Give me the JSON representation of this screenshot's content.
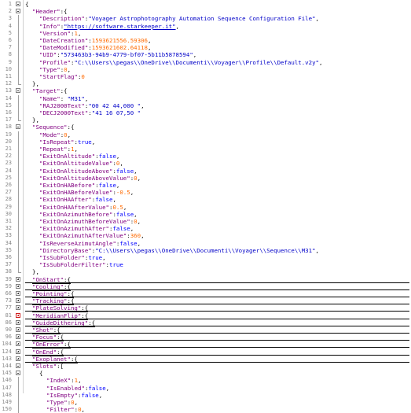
{
  "lines": [
    {
      "n": "1",
      "indent": 0,
      "fold": "minus",
      "parts": [
        {
          "t": "{",
          "c": "p"
        }
      ]
    },
    {
      "n": "2",
      "indent": 1,
      "fold": "minus",
      "parts": [
        {
          "t": "\"Header\"",
          "c": "k"
        },
        {
          "t": ":{",
          "c": "p"
        }
      ]
    },
    {
      "n": "3",
      "indent": 2,
      "fold": "",
      "parts": [
        {
          "t": "\"Description\"",
          "c": "k"
        },
        {
          "t": ":",
          "c": "p"
        },
        {
          "t": "\"Voyager Astrophotography Automation Sequence Configuration File\"",
          "c": "s"
        },
        {
          "t": ",",
          "c": "p"
        }
      ]
    },
    {
      "n": "4",
      "indent": 2,
      "fold": "",
      "parts": [
        {
          "t": "\"Info\"",
          "c": "k"
        },
        {
          "t": ":",
          "c": "p"
        },
        {
          "t": "\"https://software.starkeeper.it\"",
          "c": "u"
        },
        {
          "t": ",",
          "c": "p"
        }
      ]
    },
    {
      "n": "5",
      "indent": 2,
      "fold": "",
      "parts": [
        {
          "t": "\"Version\"",
          "c": "k"
        },
        {
          "t": ":",
          "c": "p"
        },
        {
          "t": "1",
          "c": "n"
        },
        {
          "t": ",",
          "c": "p"
        }
      ]
    },
    {
      "n": "6",
      "indent": 2,
      "fold": "",
      "parts": [
        {
          "t": "\"DateCreation\"",
          "c": "k"
        },
        {
          "t": ":",
          "c": "p"
        },
        {
          "t": "1593621556.59306",
          "c": "n"
        },
        {
          "t": ",",
          "c": "p"
        }
      ]
    },
    {
      "n": "7",
      "indent": 2,
      "fold": "",
      "parts": [
        {
          "t": "\"DateModified\"",
          "c": "k"
        },
        {
          "t": ":",
          "c": "p"
        },
        {
          "t": "1593621602.64118",
          "c": "n"
        },
        {
          "t": ",",
          "c": "p"
        }
      ]
    },
    {
      "n": "8",
      "indent": 2,
      "fold": "",
      "parts": [
        {
          "t": "\"UID\"",
          "c": "k"
        },
        {
          "t": ":",
          "c": "p"
        },
        {
          "t": "\"573463b3-94b9-4779-bf07-5b11b5878594\"",
          "c": "s"
        },
        {
          "t": ",",
          "c": "p"
        }
      ]
    },
    {
      "n": "9",
      "indent": 2,
      "fold": "",
      "parts": [
        {
          "t": "\"Profile\"",
          "c": "k"
        },
        {
          "t": ":",
          "c": "p"
        },
        {
          "t": "\"C:\\\\Users\\\\pegas\\\\OneDrive\\\\Documenti\\\\Voyager\\\\Profile\\\\Default.v2y\"",
          "c": "s"
        },
        {
          "t": ",",
          "c": "p"
        }
      ]
    },
    {
      "n": "10",
      "indent": 2,
      "fold": "",
      "parts": [
        {
          "t": "\"Type\"",
          "c": "k"
        },
        {
          "t": ":",
          "c": "p"
        },
        {
          "t": "0",
          "c": "n"
        },
        {
          "t": ",",
          "c": "p"
        }
      ]
    },
    {
      "n": "11",
      "indent": 2,
      "fold": "",
      "parts": [
        {
          "t": "\"StartFlag\"",
          "c": "k"
        },
        {
          "t": ":",
          "c": "p"
        },
        {
          "t": "0",
          "c": "n"
        }
      ]
    },
    {
      "n": "12",
      "indent": 1,
      "fold": "end",
      "parts": [
        {
          "t": "},",
          "c": "p"
        }
      ]
    },
    {
      "n": "13",
      "indent": 1,
      "fold": "minus",
      "parts": [
        {
          "t": "\"Target\"",
          "c": "k"
        },
        {
          "t": ":{",
          "c": "p"
        }
      ]
    },
    {
      "n": "14",
      "indent": 2,
      "fold": "",
      "parts": [
        {
          "t": "\"Name\"",
          "c": "k"
        },
        {
          "t": ": ",
          "c": "p"
        },
        {
          "t": "\"M31\"",
          "c": "s"
        },
        {
          "t": ",",
          "c": "p"
        }
      ]
    },
    {
      "n": "15",
      "indent": 2,
      "fold": "",
      "parts": [
        {
          "t": "\"RAJ2000Text\"",
          "c": "k"
        },
        {
          "t": ":",
          "c": "p"
        },
        {
          "t": "\"00 42 44,000 \"",
          "c": "s"
        },
        {
          "t": ",",
          "c": "p"
        }
      ]
    },
    {
      "n": "16",
      "indent": 2,
      "fold": "",
      "parts": [
        {
          "t": "\"DECJ2000Text\"",
          "c": "k"
        },
        {
          "t": ":",
          "c": "p"
        },
        {
          "t": "\"41 16 07,50 \"",
          "c": "s"
        }
      ]
    },
    {
      "n": "17",
      "indent": 1,
      "fold": "end",
      "parts": [
        {
          "t": "},",
          "c": "p"
        }
      ]
    },
    {
      "n": "18",
      "indent": 1,
      "fold": "minus",
      "parts": [
        {
          "t": "\"Sequence\"",
          "c": "k"
        },
        {
          "t": ":{",
          "c": "p"
        }
      ]
    },
    {
      "n": "19",
      "indent": 2,
      "fold": "",
      "parts": [
        {
          "t": "\"Mode\"",
          "c": "k"
        },
        {
          "t": ":",
          "c": "p"
        },
        {
          "t": "0",
          "c": "n"
        },
        {
          "t": ",",
          "c": "p"
        }
      ]
    },
    {
      "n": "20",
      "indent": 2,
      "fold": "",
      "parts": [
        {
          "t": "\"IsRepeat\"",
          "c": "k"
        },
        {
          "t": ":",
          "c": "p"
        },
        {
          "t": "true",
          "c": "b"
        },
        {
          "t": ",",
          "c": "p"
        }
      ]
    },
    {
      "n": "21",
      "indent": 2,
      "fold": "",
      "parts": [
        {
          "t": "\"Repeat\"",
          "c": "k"
        },
        {
          "t": ":",
          "c": "p"
        },
        {
          "t": "1",
          "c": "n"
        },
        {
          "t": ",",
          "c": "p"
        }
      ]
    },
    {
      "n": "22",
      "indent": 2,
      "fold": "",
      "parts": [
        {
          "t": "\"ExitOnAltitude\"",
          "c": "k"
        },
        {
          "t": ":",
          "c": "p"
        },
        {
          "t": "false",
          "c": "b"
        },
        {
          "t": ",",
          "c": "p"
        }
      ]
    },
    {
      "n": "23",
      "indent": 2,
      "fold": "",
      "parts": [
        {
          "t": "\"ExitOnAltitudeValue\"",
          "c": "k"
        },
        {
          "t": ":",
          "c": "p"
        },
        {
          "t": "0",
          "c": "n"
        },
        {
          "t": ",",
          "c": "p"
        }
      ]
    },
    {
      "n": "24",
      "indent": 2,
      "fold": "",
      "parts": [
        {
          "t": "\"ExitOnAltitudeAbove\"",
          "c": "k"
        },
        {
          "t": ":",
          "c": "p"
        },
        {
          "t": "false",
          "c": "b"
        },
        {
          "t": ",",
          "c": "p"
        }
      ]
    },
    {
      "n": "25",
      "indent": 2,
      "fold": "",
      "parts": [
        {
          "t": "\"ExitOnAltitudeAboveValue\"",
          "c": "k"
        },
        {
          "t": ":",
          "c": "p"
        },
        {
          "t": "0",
          "c": "n"
        },
        {
          "t": ",",
          "c": "p"
        }
      ]
    },
    {
      "n": "26",
      "indent": 2,
      "fold": "",
      "parts": [
        {
          "t": "\"ExitOnHABefore\"",
          "c": "k"
        },
        {
          "t": ":",
          "c": "p"
        },
        {
          "t": "false",
          "c": "b"
        },
        {
          "t": ",",
          "c": "p"
        }
      ]
    },
    {
      "n": "27",
      "indent": 2,
      "fold": "",
      "parts": [
        {
          "t": "\"ExitOnHABeforeValue\"",
          "c": "k"
        },
        {
          "t": ":",
          "c": "p"
        },
        {
          "t": "-0.5",
          "c": "n"
        },
        {
          "t": ",",
          "c": "p"
        }
      ]
    },
    {
      "n": "28",
      "indent": 2,
      "fold": "",
      "parts": [
        {
          "t": "\"ExitOnHAAfter\"",
          "c": "k"
        },
        {
          "t": ":",
          "c": "p"
        },
        {
          "t": "false",
          "c": "b"
        },
        {
          "t": ",",
          "c": "p"
        }
      ]
    },
    {
      "n": "29",
      "indent": 2,
      "fold": "",
      "parts": [
        {
          "t": "\"ExitOnHAAfterValue\"",
          "c": "k"
        },
        {
          "t": ":",
          "c": "p"
        },
        {
          "t": "0.5",
          "c": "n"
        },
        {
          "t": ",",
          "c": "p"
        }
      ]
    },
    {
      "n": "30",
      "indent": 2,
      "fold": "",
      "parts": [
        {
          "t": "\"ExitOnAzimuthBefore\"",
          "c": "k"
        },
        {
          "t": ":",
          "c": "p"
        },
        {
          "t": "false",
          "c": "b"
        },
        {
          "t": ",",
          "c": "p"
        }
      ]
    },
    {
      "n": "31",
      "indent": 2,
      "fold": "",
      "parts": [
        {
          "t": "\"ExitOnAzimuthBeforeValue\"",
          "c": "k"
        },
        {
          "t": ":",
          "c": "p"
        },
        {
          "t": "0",
          "c": "n"
        },
        {
          "t": ",",
          "c": "p"
        }
      ]
    },
    {
      "n": "32",
      "indent": 2,
      "fold": "",
      "parts": [
        {
          "t": "\"ExitOnAzimuthAfter\"",
          "c": "k"
        },
        {
          "t": ":",
          "c": "p"
        },
        {
          "t": "false",
          "c": "b"
        },
        {
          "t": ",",
          "c": "p"
        }
      ]
    },
    {
      "n": "33",
      "indent": 2,
      "fold": "",
      "parts": [
        {
          "t": "\"ExitOnAzimuthAfterValue\"",
          "c": "k"
        },
        {
          "t": ":",
          "c": "p"
        },
        {
          "t": "360",
          "c": "n"
        },
        {
          "t": ",",
          "c": "p"
        }
      ]
    },
    {
      "n": "34",
      "indent": 2,
      "fold": "",
      "parts": [
        {
          "t": "\"IsReverseAzimutAngle\"",
          "c": "k"
        },
        {
          "t": ":",
          "c": "p"
        },
        {
          "t": "false",
          "c": "b"
        },
        {
          "t": ",",
          "c": "p"
        }
      ]
    },
    {
      "n": "35",
      "indent": 2,
      "fold": "",
      "parts": [
        {
          "t": "\"DirectoryBase\"",
          "c": "k"
        },
        {
          "t": ":",
          "c": "p"
        },
        {
          "t": "\"C:\\\\Users\\\\pegas\\\\OneDrive\\\\Documenti\\\\Voyager\\\\Sequence\\\\M31\"",
          "c": "s"
        },
        {
          "t": ",",
          "c": "p"
        }
      ]
    },
    {
      "n": "36",
      "indent": 2,
      "fold": "",
      "parts": [
        {
          "t": "\"IsSubFolder\"",
          "c": "k"
        },
        {
          "t": ":",
          "c": "p"
        },
        {
          "t": "true",
          "c": "b"
        },
        {
          "t": ",",
          "c": "p"
        }
      ]
    },
    {
      "n": "37",
      "indent": 2,
      "fold": "",
      "parts": [
        {
          "t": "\"IsSubFolderFilter\"",
          "c": "k"
        },
        {
          "t": ":",
          "c": "p"
        },
        {
          "t": "true",
          "c": "b"
        }
      ]
    },
    {
      "n": "38",
      "indent": 1,
      "fold": "end",
      "parts": [
        {
          "t": "},",
          "c": "p"
        }
      ]
    },
    {
      "n": "39",
      "indent": 1,
      "fold": "plus",
      "parts": [
        {
          "t": "\"OnStart\"",
          "c": "k"
        },
        {
          "t": ":{",
          "c": "p"
        }
      ]
    },
    {
      "n": "59",
      "indent": 1,
      "fold": "plus",
      "parts": [
        {
          "t": "\"Cooling\"",
          "c": "k"
        },
        {
          "t": ":{",
          "c": "p"
        }
      ]
    },
    {
      "n": "66",
      "indent": 1,
      "fold": "plus",
      "parts": [
        {
          "t": "\"Pointing\"",
          "c": "k"
        },
        {
          "t": ":{",
          "c": "p"
        }
      ]
    },
    {
      "n": "73",
      "indent": 1,
      "fold": "plus",
      "parts": [
        {
          "t": "\"Tracking\"",
          "c": "k"
        },
        {
          "t": ":{",
          "c": "p"
        }
      ]
    },
    {
      "n": "77",
      "indent": 1,
      "fold": "plus",
      "parts": [
        {
          "t": "\"PlateSolving\"",
          "c": "k"
        },
        {
          "t": ":{",
          "c": "p"
        }
      ]
    },
    {
      "n": "81",
      "indent": 1,
      "fold": "plusred",
      "parts": [
        {
          "t": "\"MeridianFlip\"",
          "c": "k"
        },
        {
          "t": ":{",
          "c": "p"
        }
      ]
    },
    {
      "n": "86",
      "indent": 1,
      "fold": "plus",
      "parts": [
        {
          "t": "\"GuideDithering\"",
          "c": "k"
        },
        {
          "t": ":{",
          "c": "p"
        }
      ]
    },
    {
      "n": "90",
      "indent": 1,
      "fold": "plus",
      "parts": [
        {
          "t": "\"Shot\"",
          "c": "k"
        },
        {
          "t": ":{",
          "c": "p"
        }
      ]
    },
    {
      "n": "96",
      "indent": 1,
      "fold": "plus",
      "parts": [
        {
          "t": "\"Focus\"",
          "c": "k"
        },
        {
          "t": ":{",
          "c": "p"
        }
      ]
    },
    {
      "n": "104",
      "indent": 1,
      "fold": "plus",
      "parts": [
        {
          "t": "\"OnError\"",
          "c": "k"
        },
        {
          "t": ":{",
          "c": "p"
        }
      ]
    },
    {
      "n": "124",
      "indent": 1,
      "fold": "plus",
      "parts": [
        {
          "t": "\"OnEnd\"",
          "c": "k"
        },
        {
          "t": ":{",
          "c": "p"
        }
      ]
    },
    {
      "n": "143",
      "indent": 1,
      "fold": "plus",
      "parts": [
        {
          "t": "\"Exoplanet\"",
          "c": "k"
        },
        {
          "t": ":{",
          "c": "p"
        }
      ]
    },
    {
      "n": "144",
      "indent": 1,
      "fold": "minus",
      "parts": [
        {
          "t": "\"Slots\"",
          "c": "k"
        },
        {
          "t": ":[",
          "c": "p"
        }
      ]
    },
    {
      "n": "145",
      "indent": 2,
      "fold": "minus",
      "parts": [
        {
          "t": "{",
          "c": "p"
        }
      ]
    },
    {
      "n": "146",
      "indent": 3,
      "fold": "",
      "parts": [
        {
          "t": "\"IndeX\"",
          "c": "k"
        },
        {
          "t": ":",
          "c": "p"
        },
        {
          "t": "1",
          "c": "n"
        },
        {
          "t": ",",
          "c": "p"
        }
      ]
    },
    {
      "n": "147",
      "indent": 3,
      "fold": "",
      "parts": [
        {
          "t": "\"IsEnabled\"",
          "c": "k"
        },
        {
          "t": ":",
          "c": "p"
        },
        {
          "t": "false",
          "c": "b"
        },
        {
          "t": ",",
          "c": "p"
        }
      ]
    },
    {
      "n": "148",
      "indent": 3,
      "fold": "",
      "parts": [
        {
          "t": "\"IsEmpty\"",
          "c": "k"
        },
        {
          "t": ":",
          "c": "p"
        },
        {
          "t": "false",
          "c": "b"
        },
        {
          "t": ",",
          "c": "p"
        }
      ]
    },
    {
      "n": "149",
      "indent": 3,
      "fold": "",
      "parts": [
        {
          "t": "\"Type\"",
          "c": "k"
        },
        {
          "t": ":",
          "c": "p"
        },
        {
          "t": "0",
          "c": "n"
        },
        {
          "t": ",",
          "c": "p"
        }
      ]
    },
    {
      "n": "150",
      "indent": 3,
      "fold": "",
      "parts": [
        {
          "t": "\"Filter\"",
          "c": "k"
        },
        {
          "t": ":",
          "c": "p"
        },
        {
          "t": "0",
          "c": "n"
        },
        {
          "t": ",",
          "c": "p"
        }
      ]
    }
  ]
}
